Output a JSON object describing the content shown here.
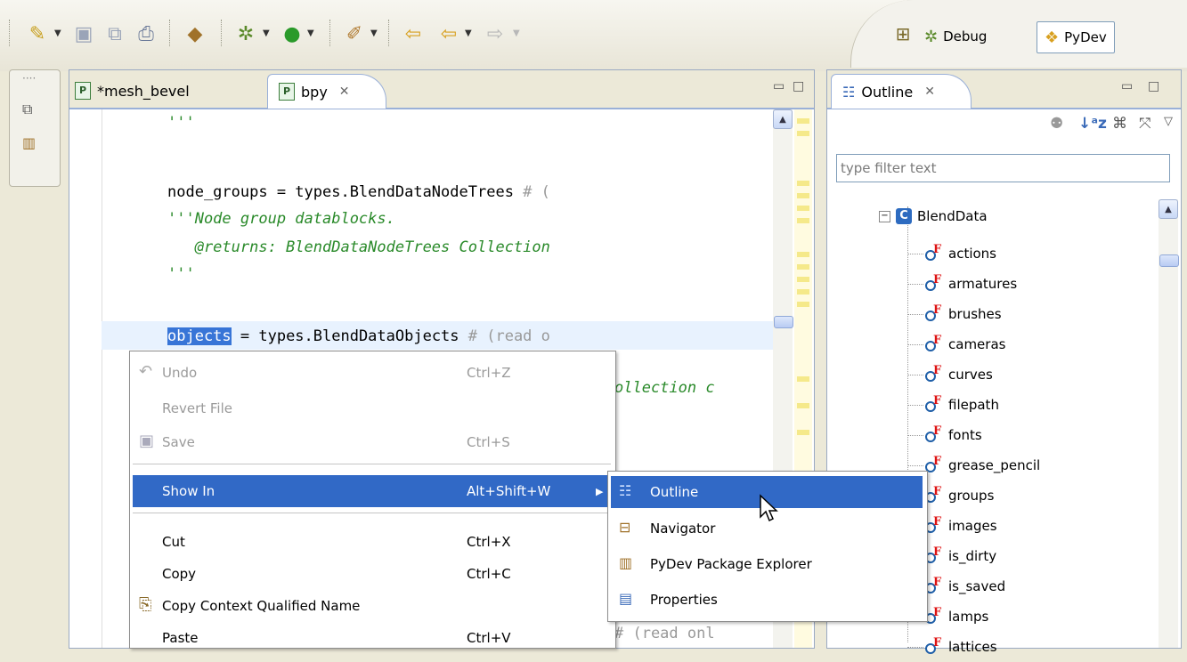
{
  "toolbar": {
    "icons": [
      "new-wizard-icon",
      "save-icon",
      "save-all-icon",
      "print-icon",
      "new-pydev-project-icon",
      "debug-icon",
      "run-icon",
      "external-tools-icon",
      "last-edit-location-icon",
      "back-icon",
      "forward-icon"
    ]
  },
  "perspectives": {
    "debug_label": "Debug",
    "pydev_label": "PyDev"
  },
  "editor": {
    "tabs": [
      {
        "label": "*mesh_bevel"
      },
      {
        "label": "bpy",
        "close": "✕"
      }
    ],
    "code": {
      "l1": "'''",
      "l2a": "node_groups = types.BlendDataNodeTrees ",
      "l2b": "# (",
      "l3": "'''Node group datablocks.",
      "l4": "   @returns: BlendDataNodeTrees Collection",
      "l5": "'''",
      "l6a": "objects",
      "l6b": " = types.BlendDataObjects ",
      "l6c": "# (read o",
      "l7": "ollection c",
      "l8": "# (read onl"
    }
  },
  "outline": {
    "tab_label": "Outline",
    "close": "✕",
    "filter_placeholder": "type filter text",
    "root": "BlendData",
    "items": [
      "actions",
      "armatures",
      "brushes",
      "cameras",
      "curves",
      "filepath",
      "fonts",
      "grease_pencil",
      "groups",
      "images",
      "is_dirty",
      "is_saved",
      "lamps",
      "lattices"
    ]
  },
  "context_menu": {
    "items": [
      {
        "label": "Undo",
        "shortcut": "Ctrl+Z",
        "disabled": true
      },
      {
        "label": "Revert File",
        "shortcut": "",
        "disabled": true
      },
      {
        "label": "Save",
        "shortcut": "Ctrl+S",
        "disabled": true
      },
      {
        "label": "Show In",
        "shortcut": "Alt+Shift+W",
        "highlighted": true
      },
      {
        "label": "Cut",
        "shortcut": "Ctrl+X"
      },
      {
        "label": "Copy",
        "shortcut": "Ctrl+C"
      },
      {
        "label": "Copy Context Qualified Name",
        "shortcut": ""
      },
      {
        "label": "Paste",
        "shortcut": "Ctrl+V"
      }
    ]
  },
  "submenu": {
    "items": [
      {
        "label": "Outline",
        "highlighted": true
      },
      {
        "label": "Navigator"
      },
      {
        "label": "PyDev Package Explorer"
      },
      {
        "label": "Properties"
      }
    ]
  },
  "colors": {
    "selection": "#3169c6",
    "comment": "#2a8a2a",
    "chrome": "#ece9d8"
  }
}
